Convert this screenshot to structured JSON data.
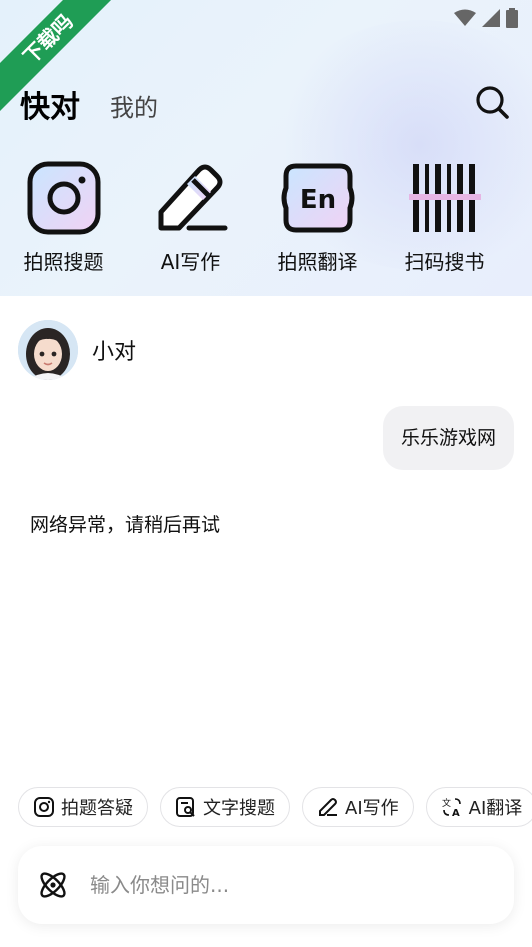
{
  "watermark": {
    "text": "下载吗"
  },
  "status_bar": {
    "icons": [
      "wifi-icon",
      "signal-icon",
      "battery-icon"
    ]
  },
  "tabs": {
    "active": "快对",
    "other": "我的"
  },
  "tools": [
    {
      "label": "拍照搜题",
      "icon": "camera-icon"
    },
    {
      "label": "AI写作",
      "icon": "pen-icon"
    },
    {
      "label": "拍照翻译",
      "icon": "translate-en-icon"
    },
    {
      "label": "扫码搜书",
      "icon": "barcode-icon"
    }
  ],
  "chat": {
    "bot_name": "小对",
    "user_message": "乐乐游戏网",
    "bot_reply": "网络异常，请稍后再试"
  },
  "chips": [
    {
      "label": "拍题答疑",
      "icon": "camera-icon"
    },
    {
      "label": "文字搜题",
      "icon": "doc-search-icon"
    },
    {
      "label": "AI写作",
      "icon": "pen-icon"
    },
    {
      "label": "AI翻译",
      "icon": "translate-icon"
    }
  ],
  "input": {
    "placeholder": "输入你想问的..."
  },
  "colors": {
    "watermark_green": "#1f9d55",
    "header_bg": "#e6f1fb"
  }
}
